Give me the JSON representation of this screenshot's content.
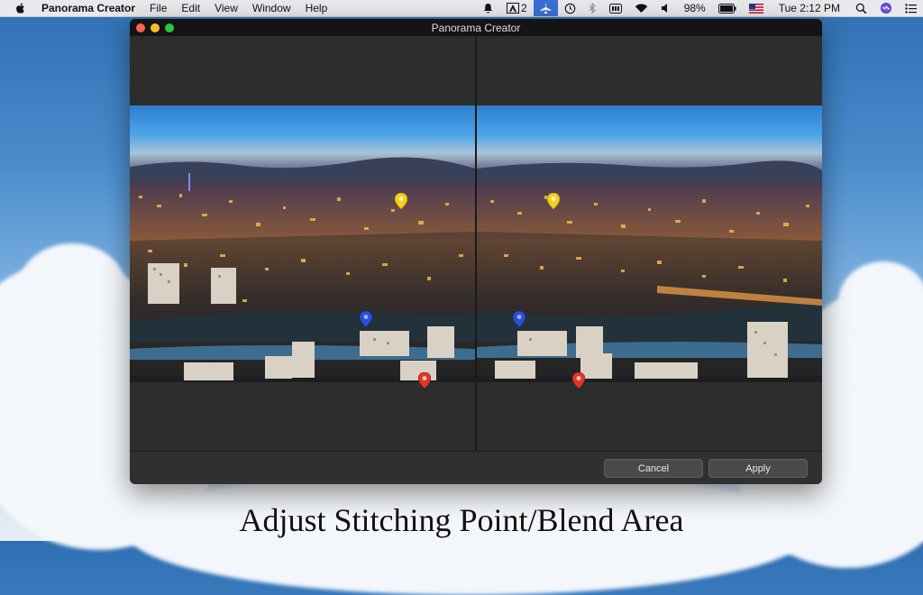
{
  "menubar": {
    "app_name": "Panorama Creator",
    "menus": [
      "File",
      "Edit",
      "View",
      "Window",
      "Help"
    ],
    "status": {
      "adobe_badge": "2",
      "battery": "98%",
      "clock": "Tue 2:12 PM"
    },
    "icons": [
      "bell-icon",
      "adobe-icon",
      "airplane-icon",
      "time-machine-icon",
      "bluetooth-icon",
      "battery-status-icon",
      "wifi-icon",
      "volume-icon",
      "flag-icon",
      "search-icon",
      "siri-icon",
      "list-icon"
    ]
  },
  "window": {
    "title": "Panorama Creator",
    "cancel_label": "Cancel",
    "apply_label": "Apply"
  },
  "panes": {
    "left": {
      "pins": [
        {
          "color": "#f2d01e",
          "name": "yellow"
        },
        {
          "color": "#2a4fd8",
          "name": "blue"
        },
        {
          "color": "#e0352b",
          "name": "red"
        }
      ]
    },
    "right": {
      "pins": [
        {
          "color": "#f2d01e",
          "name": "yellow"
        },
        {
          "color": "#2a4fd8",
          "name": "blue"
        },
        {
          "color": "#e0352b",
          "name": "red"
        }
      ]
    }
  },
  "caption": "Adjust Stitching Point/Blend Area"
}
